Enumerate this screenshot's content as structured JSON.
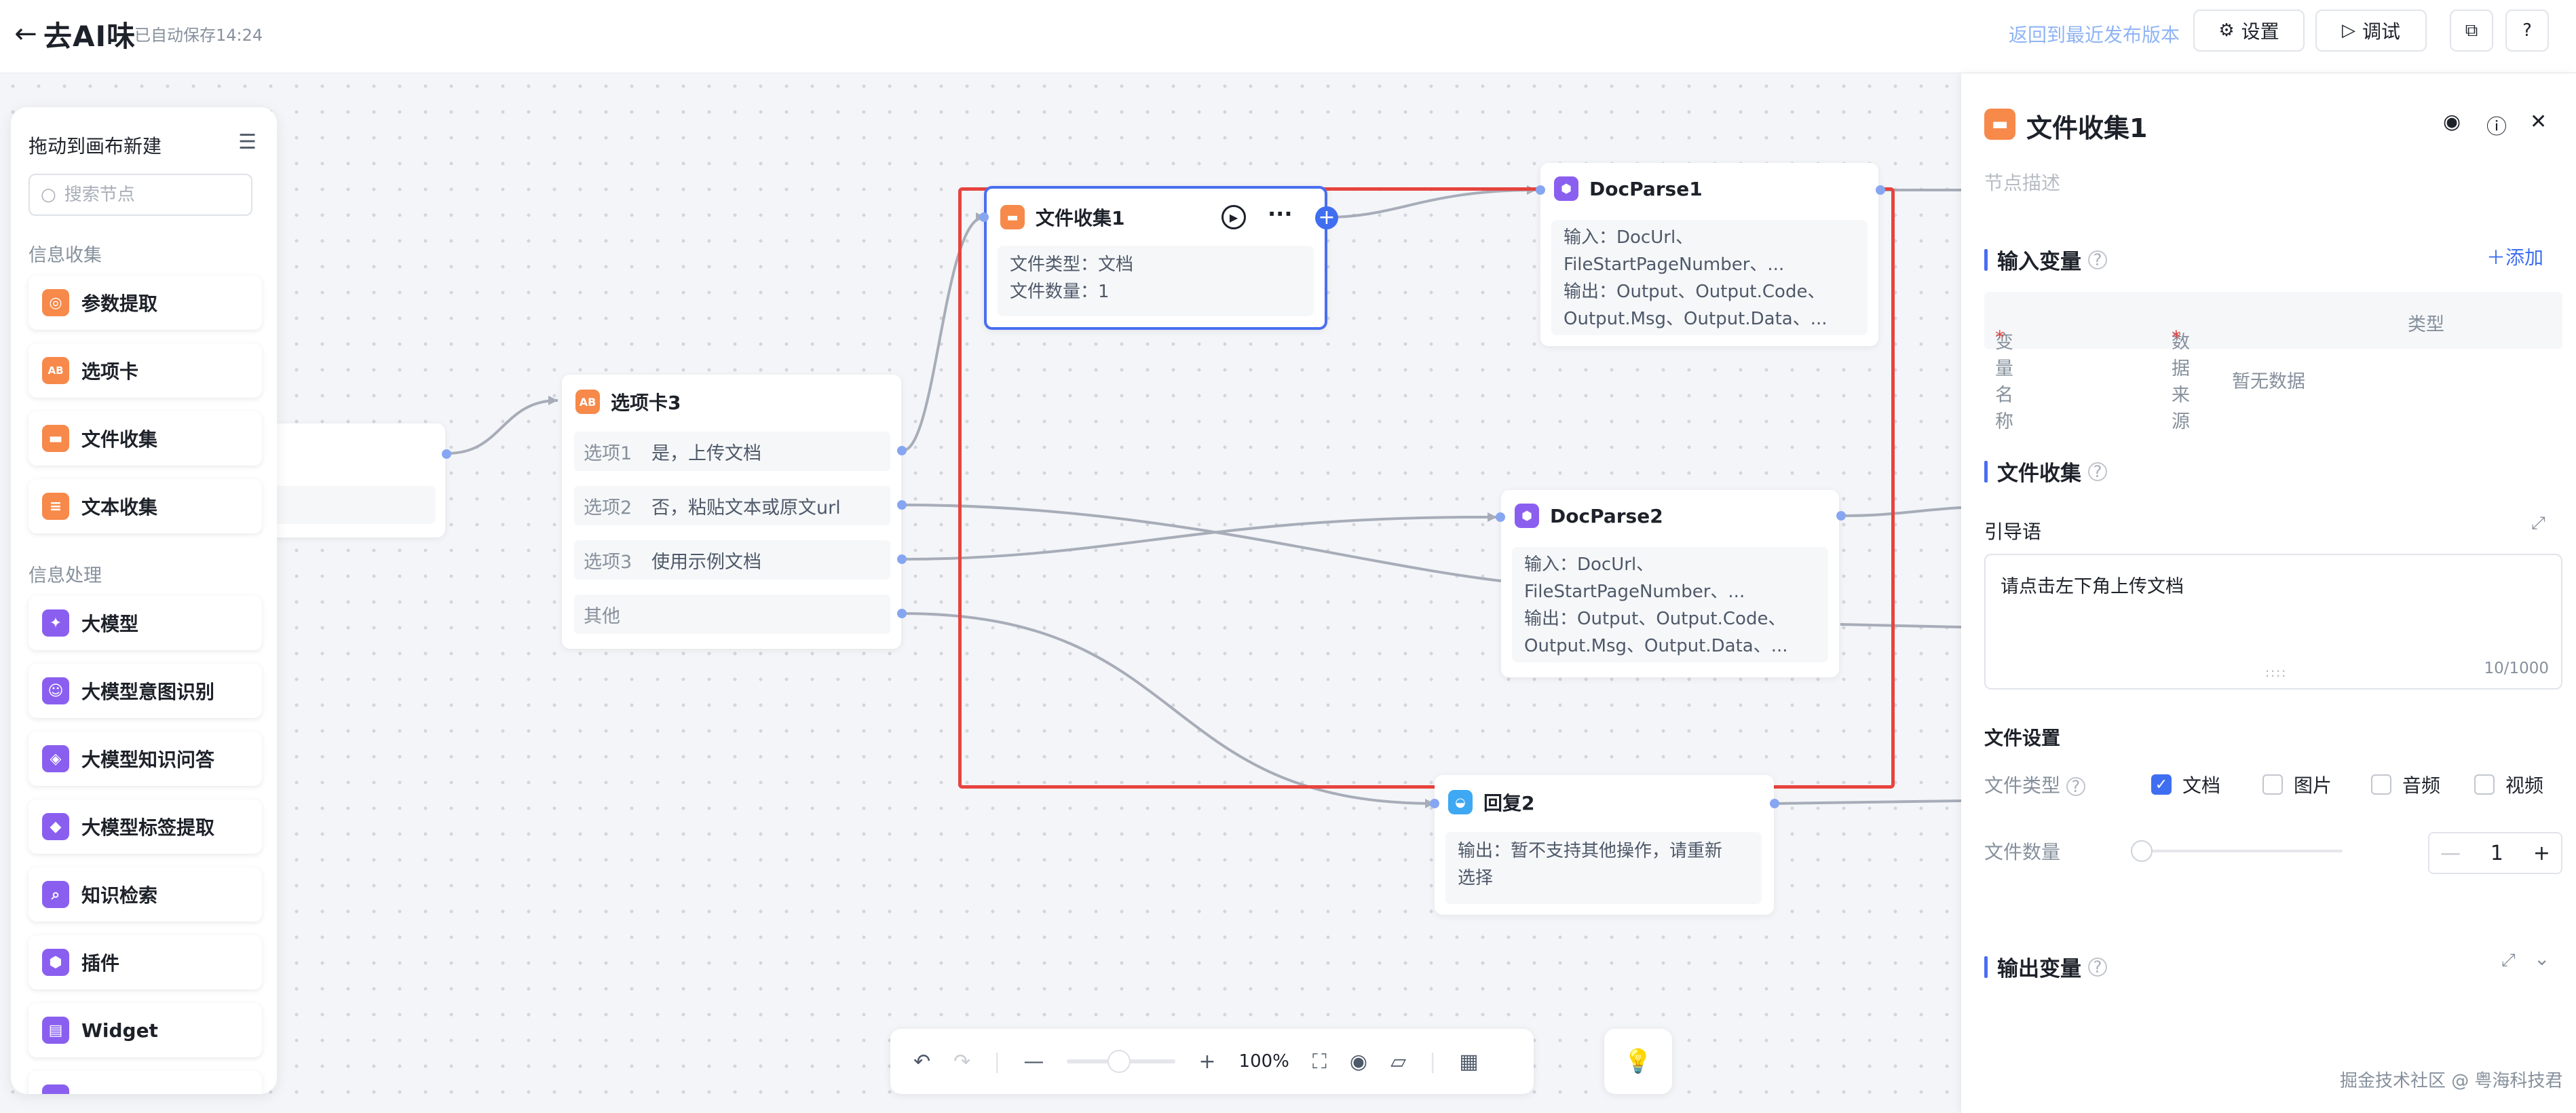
{
  "topbar": {
    "back_icon": "arrow-left-icon",
    "app_title": "去AI味",
    "autosave": "已自动保存14:24",
    "revert_link": "返回到最近发布版本",
    "settings_label": "设置",
    "debug_label": "调试"
  },
  "node_panel": {
    "title": "拖动到画布新建",
    "search_placeholder": "搜索节点",
    "section_collect": "信息收集",
    "section_process": "信息处理",
    "collect_items": [
      {
        "label": "参数提取",
        "icon": "param-extract-icon",
        "color": "#f7894a"
      },
      {
        "label": "选项卡",
        "icon": "tab-card-icon",
        "color": "#f7894a"
      },
      {
        "label": "文件收集",
        "icon": "folder-icon",
        "color": "#f7894a"
      },
      {
        "label": "文本收集",
        "icon": "text-doc-icon",
        "color": "#f7894a"
      }
    ],
    "process_items": [
      {
        "label": "大模型",
        "icon": "sparkle-icon",
        "color": "#8a5ff0"
      },
      {
        "label": "大模型意图识别",
        "icon": "robot-icon",
        "color": "#8a5ff0"
      },
      {
        "label": "大模型知识问答",
        "icon": "qa-icon",
        "color": "#8a5ff0"
      },
      {
        "label": "大模型标签提取",
        "icon": "tag-icon",
        "color": "#8a5ff0"
      },
      {
        "label": "知识检索",
        "icon": "search-doc-icon",
        "color": "#8a5ff0"
      },
      {
        "label": "插件",
        "icon": "plugin-icon",
        "color": "#8a5ff0"
      },
      {
        "label": "Widget",
        "icon": "widget-icon",
        "color": "#8a5ff0"
      }
    ]
  },
  "nodes": {
    "file_collect": {
      "title": "文件收集1",
      "line1": "文件类型：文档",
      "line2": "文件数量：1"
    },
    "tab_card": {
      "title": "选项卡3",
      "options": [
        {
          "label": "选项1",
          "value": "是，上传文档"
        },
        {
          "label": "选项2",
          "value": "否，粘贴文本或原文url"
        },
        {
          "label": "选项3",
          "value": "使用示例文档"
        },
        {
          "label": "其他",
          "value": ""
        }
      ]
    },
    "docparse1": {
      "title": "DocParse1",
      "in1": "输入：DocUrl、",
      "in2": "FileStartPageNumber、...",
      "out1": "输出：Output、Output.Code、",
      "out2": "Output.Msg、Output.Data、..."
    },
    "docparse2": {
      "title": "DocParse2",
      "in1": "输入：DocUrl、",
      "in2": "FileStartPageNumber、...",
      "out1": "输出：Output、Output.Code、",
      "out2": "Output.Msg、Output.Data、..."
    },
    "reply2": {
      "title": "回复2",
      "line1": "输出：暂不支持其他操作，请重新",
      "line2": "选择"
    }
  },
  "bottom_toolbar": {
    "zoom": "100%"
  },
  "right_panel": {
    "title": "文件收集1",
    "description_placeholder": "节点描述",
    "input_vars_title": "输入变量",
    "add_label": "添加",
    "col_name": "变量名称",
    "col_source": "数据来源",
    "col_type": "类型",
    "empty_text": "暂无数据",
    "file_collect_title": "文件收集",
    "prompt_label": "引导语",
    "prompt_value": "请点击左下角上传文档",
    "prompt_count": "10/1000",
    "file_settings_title": "文件设置",
    "file_type_label": "文件类型",
    "file_types": [
      {
        "label": "文档",
        "checked": true
      },
      {
        "label": "图片",
        "checked": false
      },
      {
        "label": "音频",
        "checked": false
      },
      {
        "label": "视频",
        "checked": false
      }
    ],
    "file_count_label": "文件数量",
    "file_count_value": "1",
    "output_vars_title": "输出变量"
  },
  "watermark": "掘金技术社区 @ 粤海科技君",
  "colors": {
    "accent": "#3f6ef0",
    "node_border": "#4a6ef0",
    "highlight_frame": "#e7433f",
    "orange": "#f7894a",
    "purple": "#8a5ff0"
  }
}
